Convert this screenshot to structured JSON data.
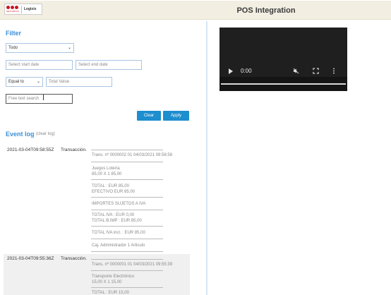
{
  "header": {
    "title": "POS Integration",
    "logo": {
      "brand": "SECURITAS",
      "product": "Logixis"
    }
  },
  "filter": {
    "heading": "Filter",
    "type_select": "Todo",
    "start_date_placeholder": "Select start date",
    "end_date_placeholder": "Select end date",
    "operator_select": "Equal to",
    "total_value_placeholder": "Total Value",
    "free_text_placeholder": "Free text search",
    "clear_label": "Clear",
    "apply_label": "Apply"
  },
  "event_log": {
    "heading": "Event log",
    "clear_link": "(clear log)",
    "entries": [
      {
        "timestamp": "2021-03-04T09:58:55Z",
        "label": "Transacción.",
        "lines": [
          "Trans. nº 0000002 01 04/03/2021 09:58:58",
          "Juegos Lotería",
          "85,00 X 1 85,00",
          "TOTAL : EUR 85,00",
          "EFECTIVO EUR 85,00",
          "IMPORTES SUJETOS A IVA",
          "TOTAL IVA : EUR 0,00",
          "TOTAL B.IMP : EUR 85,00",
          "TOTAL IVA incl. : EUR 85,00",
          "Caj. Administrador 1 Articulo"
        ]
      },
      {
        "timestamp": "2021-03-04T09:55:36Z",
        "label": "Transacción.",
        "lines": [
          "Trans. nº 0000001 01 04/03/2021 09:55:39",
          "Transporte Electrónico",
          "15,00 X 1 15,00",
          "TOTAL : EUR 15,00"
        ]
      }
    ]
  },
  "video": {
    "time": "0:00",
    "icons": [
      "play-icon",
      "mute-icon",
      "fullscreen-icon",
      "more-options-icon"
    ]
  },
  "colors": {
    "accent": "#3b8fd6",
    "button": "#1d8ece",
    "header_bg": "#f2eee2",
    "brand_red": "#c8171e"
  }
}
